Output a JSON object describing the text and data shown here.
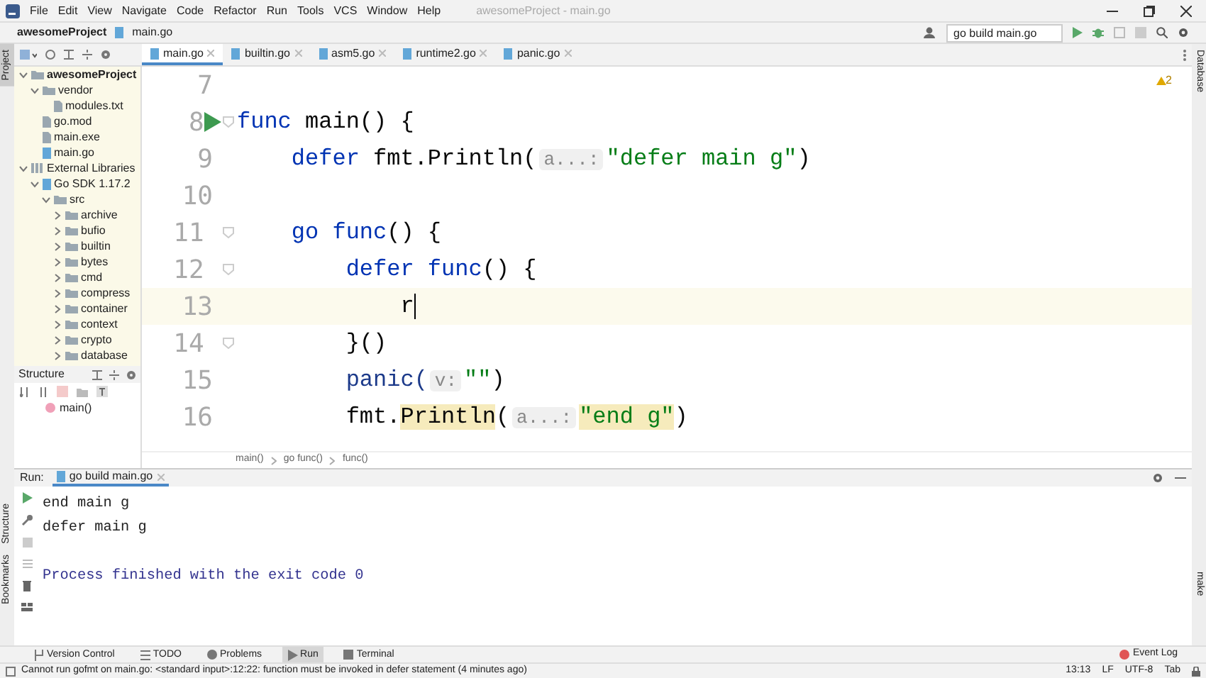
{
  "window": {
    "title": "awesomeProject - main.go"
  },
  "menu": [
    "File",
    "Edit",
    "View",
    "Navigate",
    "Code",
    "Refactor",
    "Run",
    "Tools",
    "VCS",
    "Window",
    "Help"
  ],
  "nav_path": [
    "awesomeProject",
    "main.go"
  ],
  "run_config": "go build main.go",
  "left_strip": [
    {
      "label": "Project",
      "selected": true
    },
    {
      "label": "Structure",
      "selected": false
    },
    {
      "label": "Bookmarks",
      "selected": false
    }
  ],
  "right_strip": [
    "Database",
    "make"
  ],
  "tabs": [
    {
      "label": "main.go",
      "selected": true
    },
    {
      "label": "builtin.go",
      "selected": false
    },
    {
      "label": "asm5.go",
      "selected": false
    },
    {
      "label": "runtime2.go",
      "selected": false
    },
    {
      "label": "panic.go",
      "selected": false
    }
  ],
  "project_tree": [
    {
      "label": "awesomeProject",
      "kind": "project",
      "expanded": true,
      "children": [
        {
          "label": "vendor",
          "kind": "folder",
          "expanded": true,
          "children": [
            {
              "label": "modules.txt",
              "kind": "file"
            }
          ]
        },
        {
          "label": "go.mod",
          "kind": "file"
        },
        {
          "label": "main.exe",
          "kind": "file"
        },
        {
          "label": "main.go",
          "kind": "gofile"
        }
      ]
    },
    {
      "label": "External Libraries",
      "kind": "library",
      "expanded": true,
      "children": [
        {
          "label": "Go SDK 1.17.2",
          "kind": "sdk",
          "expanded": true,
          "children": [
            {
              "label": "src",
              "kind": "folder",
              "expanded": true,
              "children": [
                {
                  "label": "archive",
                  "kind": "folder",
                  "expanded": false
                },
                {
                  "label": "bufio",
                  "kind": "folder",
                  "expanded": false
                },
                {
                  "label": "builtin",
                  "kind": "folder",
                  "expanded": false
                },
                {
                  "label": "bytes",
                  "kind": "folder",
                  "expanded": false
                },
                {
                  "label": "cmd",
                  "kind": "folder",
                  "expanded": false
                },
                {
                  "label": "compress",
                  "kind": "folder",
                  "expanded": false
                },
                {
                  "label": "container",
                  "kind": "folder",
                  "expanded": false
                },
                {
                  "label": "context",
                  "kind": "folder",
                  "expanded": false
                },
                {
                  "label": "crypto",
                  "kind": "folder",
                  "expanded": false
                },
                {
                  "label": "database",
                  "kind": "folder",
                  "expanded": false
                }
              ]
            }
          ]
        }
      ]
    }
  ],
  "structure": {
    "title": "Structure",
    "items": [
      "main()"
    ]
  },
  "editor": {
    "warning_count": "2",
    "lines": [
      {
        "number": "7",
        "run": false,
        "fold": false,
        "current": false
      },
      {
        "number": "8",
        "run": true,
        "fold": true,
        "current": false,
        "segments": [
          {
            "kind": "kw",
            "text": "func"
          },
          {
            "kind": "plain",
            "text": " main() {"
          }
        ]
      },
      {
        "number": "9",
        "run": false,
        "fold": false,
        "current": false,
        "segments": [
          {
            "kind": "kw",
            "text": "    defer"
          },
          {
            "kind": "plain",
            "text": " fmt.Println("
          },
          {
            "kind": "hint",
            "text": "a...:"
          },
          {
            "kind": "str",
            "text": "\"defer main g\""
          },
          {
            "kind": "plain",
            "text": ")"
          }
        ]
      },
      {
        "number": "10",
        "run": false,
        "fold": false,
        "current": false
      },
      {
        "number": "11",
        "run": false,
        "fold": true,
        "current": false,
        "segments": [
          {
            "kind": "kw",
            "text": "    go func"
          },
          {
            "kind": "plain",
            "text": "() {"
          }
        ]
      },
      {
        "number": "12",
        "run": false,
        "fold": true,
        "current": false,
        "segments": [
          {
            "kind": "kw",
            "text": "        defer func"
          },
          {
            "kind": "plain",
            "text": "() {"
          }
        ]
      },
      {
        "number": "13",
        "run": false,
        "fold": false,
        "current": true,
        "segments": [
          {
            "kind": "plain",
            "text": "            r"
          }
        ]
      },
      {
        "number": "14",
        "run": false,
        "fold": true,
        "current": false,
        "segments": [
          {
            "kind": "plain",
            "text": "        }()"
          }
        ]
      },
      {
        "number": "15",
        "run": false,
        "fold": false,
        "current": false,
        "segments": [
          {
            "kind": "fn",
            "text": "        panic("
          },
          {
            "kind": "hint",
            "text": "v:"
          },
          {
            "kind": "str",
            "text": "\"\""
          },
          {
            "kind": "plain",
            "text": ")"
          }
        ]
      },
      {
        "number": "16",
        "run": false,
        "fold": false,
        "current": false,
        "segments": [
          {
            "kind": "plain",
            "text": "        fmt."
          },
          {
            "kind": "hl",
            "text": "Println"
          },
          {
            "kind": "plain",
            "text": "("
          },
          {
            "kind": "hint",
            "text": "a...:"
          },
          {
            "kind": "hlstr",
            "text": "\"end g\""
          },
          {
            "kind": "plain",
            "text": ")"
          }
        ]
      }
    ],
    "breadcrumbs": [
      "main()",
      "go func()",
      "func()"
    ]
  },
  "run_panel": {
    "label": "Run:",
    "tab": "go build main.go",
    "output": [
      {
        "kind": "out",
        "text": "end main g"
      },
      {
        "kind": "out",
        "text": "defer main g"
      },
      {
        "kind": "info",
        "text": "Process finished with the exit code 0"
      }
    ]
  },
  "bottom_tabs": [
    {
      "label": "Version Control",
      "selected": false
    },
    {
      "label": "TODO",
      "selected": false
    },
    {
      "label": "Problems",
      "selected": false
    },
    {
      "label": "Run",
      "selected": true
    },
    {
      "label": "Terminal",
      "selected": false
    }
  ],
  "event_log": "Event Log",
  "status_bar": {
    "message": "Cannot run gofmt on main.go: <standard input>:12:22: function must be invoked in defer statement (4 minutes ago)",
    "items": [
      "13:13",
      "LF",
      "UTF-8",
      "Tab"
    ]
  }
}
